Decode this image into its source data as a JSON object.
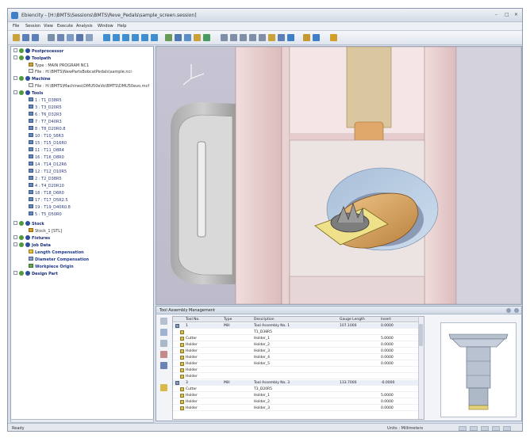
{
  "window": {
    "title": "Ebiencity - [H:\\BMTS\\Sessions\\BMTS\\Reve_Pedals\\sample_screen.session]",
    "controls": [
      "–",
      "□",
      "✕"
    ]
  },
  "menu": [
    "File",
    "Session",
    "View",
    "Execute",
    "Analysis",
    "Window",
    "Help"
  ],
  "toolbar": {
    "icons": [
      "open-session-icon",
      "save-session-icon",
      "save-icon",
      "settings-icon",
      "cut-icon",
      "copy-icon",
      "tool-manager-icon",
      "library-icon",
      "view-front-icon",
      "view-back-icon",
      "view-left-icon",
      "view-right-icon",
      "view-top-icon",
      "view-iso-icon",
      "render-icon",
      "section-icon",
      "fit-icon",
      "select-icon",
      "play-icon",
      "zoom-window-icon",
      "zoom-in-icon",
      "zoom-out-icon",
      "pan-icon",
      "rotate-icon",
      "reset-view-icon",
      "measure-icon",
      "settings-panel-icon",
      "info-icon",
      "machine-icon",
      "help-icon"
    ]
  },
  "tree": {
    "postprocessor": "Postprocessor",
    "toolpath": "Toolpath",
    "toolpath_type": "Type : MAIN PROGRAM NC1",
    "toolpath_file": "File : H:\\BMTS\\NewPartsBobcatPedals\\sample.nci",
    "machine": "Machine",
    "machine_file": "File : H:\\BMTS\\Machines\\DMU50eVo\\BMTS\\DMU50evo.mcf",
    "tools": "Tools",
    "tool_items": [
      "1 : T1_D38R5",
      "3 : T3_D20R5",
      "6 : T6_D32R3",
      "7 : T7_D40R3",
      "8 : T8_D20R0.8",
      "10 : T10_S6R3",
      "15 : T15_D16R0",
      "11 : T11_D8R4",
      "16 : T16_D8R0",
      "14 : T14_D12R6",
      "12 : T12_D10R5",
      "2 : T2_D38R5",
      "4 : T4_D20R10",
      "18 : T18_D6R0",
      "17 : T17_D5R2.5",
      "19 : T19_D40R0.8",
      "5 : T5_D50R0"
    ],
    "stock": "Stock",
    "stock_item": "Stock_1 [STL]",
    "fixtures": "Fixtures",
    "job_data": "Job Data",
    "length_comp": "Length Compensation",
    "diameter_comp": "Diameter Compensation",
    "workpiece_origin": "Workpiece Origin",
    "design_part": "Design Part"
  },
  "panel": {
    "title": "Tool Assembly Management",
    "columns": [
      "Tool No.",
      "Type",
      "Description",
      "Gauge Length",
      "Insert"
    ],
    "rows": [
      {
        "no": "1",
        "type": "Mill",
        "desc": "Tool Assembly No. 1",
        "gauge": "107.1000",
        "insert": "0.0000",
        "kind": "assembly"
      },
      {
        "no": "",
        "type": "",
        "desc": "T1_D38R5",
        "gauge": "",
        "insert": "",
        "kind": "part"
      },
      {
        "no": "Cutter",
        "type": "",
        "desc": "Holder_1",
        "gauge": "",
        "insert": "5.0000",
        "kind": "part"
      },
      {
        "no": "Holder",
        "type": "",
        "desc": "Holder_2",
        "gauge": "",
        "insert": "0.0000",
        "kind": "part"
      },
      {
        "no": "Holder",
        "type": "",
        "desc": "Holder_3",
        "gauge": "",
        "insert": "0.0000",
        "kind": "part"
      },
      {
        "no": "Holder",
        "type": "",
        "desc": "Holder_4",
        "gauge": "",
        "insert": "0.0000",
        "kind": "part"
      },
      {
        "no": "Holder",
        "type": "",
        "desc": "Holder_5",
        "gauge": "",
        "insert": "0.0000",
        "kind": "part"
      },
      {
        "no": "Holder",
        "type": "",
        "desc": "",
        "gauge": "",
        "insert": "",
        "kind": "part"
      },
      {
        "no": "Holder",
        "type": "",
        "desc": "",
        "gauge": "",
        "insert": "",
        "kind": "part"
      },
      {
        "no": "3",
        "type": "Mill",
        "desc": "Tool Assembly No. 3",
        "gauge": "133.7000",
        "insert": "-0.0000",
        "kind": "assembly"
      },
      {
        "no": "Cutter",
        "type": "",
        "desc": "T3_D20R5",
        "gauge": "",
        "insert": "",
        "kind": "part"
      },
      {
        "no": "Holder",
        "type": "",
        "desc": "Holder_1",
        "gauge": "",
        "insert": "5.0000",
        "kind": "part"
      },
      {
        "no": "Holder",
        "type": "",
        "desc": "Holder_2",
        "gauge": "",
        "insert": "0.0000",
        "kind": "part"
      },
      {
        "no": "Holder",
        "type": "",
        "desc": "Holder_3",
        "gauge": "",
        "insert": "0.0000",
        "kind": "part"
      }
    ]
  },
  "status": {
    "left": "Ready",
    "units": "Units : Millimeters"
  }
}
